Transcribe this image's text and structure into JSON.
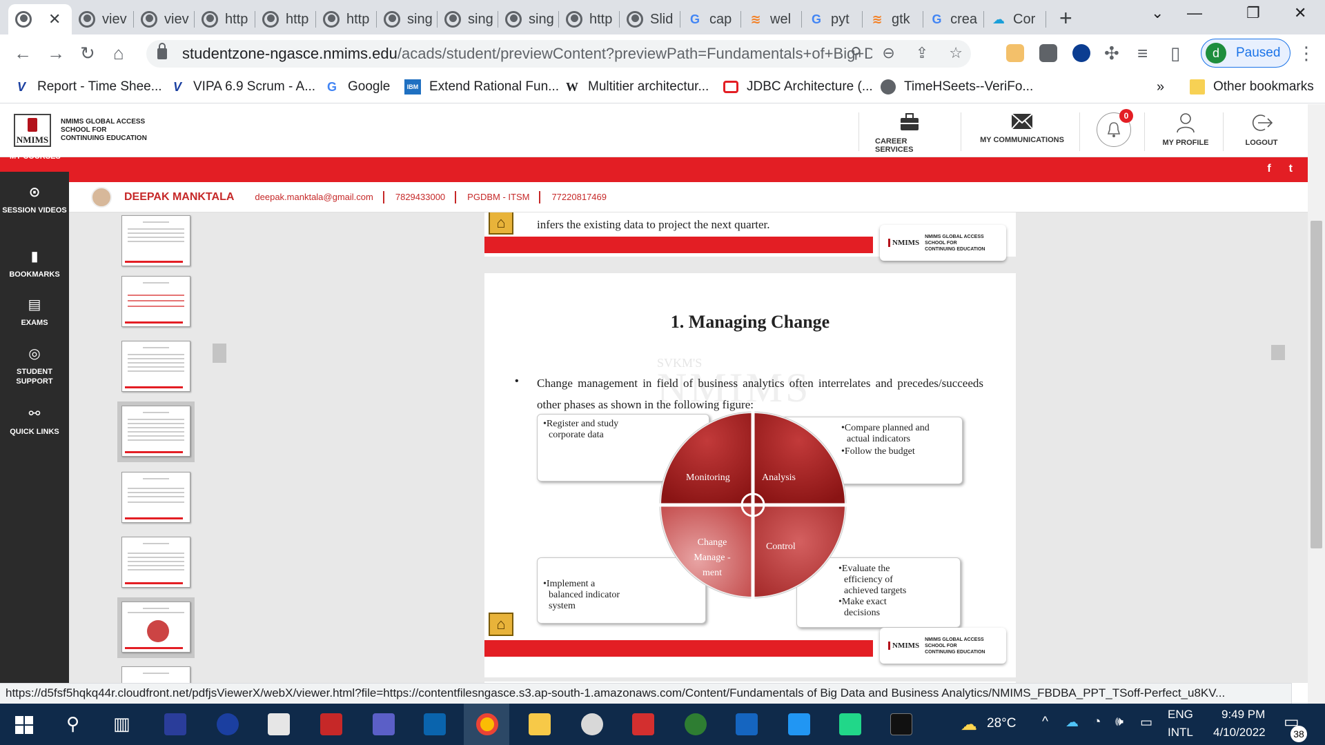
{
  "browser": {
    "tabs": [
      {
        "label": "",
        "active": true
      },
      {
        "label": "viev"
      },
      {
        "label": "viev"
      },
      {
        "label": "http"
      },
      {
        "label": "http"
      },
      {
        "label": "http"
      },
      {
        "label": "sing"
      },
      {
        "label": "sing"
      },
      {
        "label": "sing"
      },
      {
        "label": "http"
      },
      {
        "label": "Slid"
      },
      {
        "label": "cap"
      },
      {
        "label": "wel"
      },
      {
        "label": "pyt"
      },
      {
        "label": "gtk"
      },
      {
        "label": "crea"
      },
      {
        "label": "Cor"
      }
    ],
    "url_host": "studentzone-ngasce.nmims.edu",
    "url_path": "/acads/student/previewContent?previewPath=Fundamentals+of+Big+D...",
    "profile_initial": "d",
    "profile_label": "Paused",
    "bookmarks": [
      "Report - Time Shee...",
      "VIPA 6.9 Scrum - A...",
      "Google",
      "Extend Rational Fun...",
      "Multitier architectur...",
      "JDBC Architecture (...",
      "TimeHSeets--VeriFo..."
    ],
    "bookmarks_more": "»",
    "other_bookmarks": "Other bookmarks",
    "status_url": "https://d5fsf5hqkq44r.cloudfront.net/pdfjsViewerX/webX/viewer.html?file=https://contentfilesngasce.s3.ap-south-1.amazonaws.com/Content/Fundamentals of Big Data and Business Analytics/NMIMS_FBDBA_PPT_TSoff-Perfect_u8KV..."
  },
  "site": {
    "logo_abbr": "NMIMS",
    "logo_text": "NMIMS GLOBAL ACCESS SCHOOL FOR CONTINUING EDUCATION",
    "header_items": [
      "CAREER SERVICES",
      "MY COMMUNICATIONS",
      "MY PROFILE",
      "LOGOUT"
    ],
    "notification_count": "0",
    "my_courses": "MY COURSES",
    "social": [
      "f",
      "t"
    ]
  },
  "user": {
    "name": "DEEPAK MANKTALA",
    "email": "deepak.manktala@gmail.com",
    "phone": "7829433000",
    "program": "PGDBM - ITSM",
    "id": "77220817469"
  },
  "sidebar": {
    "items": [
      "SESSION VIDEOS",
      "BOOKMARKS",
      "EXAMS",
      "STUDENT SUPPORT",
      "QUICK LINKS"
    ]
  },
  "slide_prev": {
    "text": "infers the existing data to project the next quarter."
  },
  "slide": {
    "title": "1. Managing Change",
    "body": "Change management in field of business analytics often interrelates and precedes/succeeds other phases as shown in the following figure:",
    "watermark_small": "SVKM'S",
    "watermark_big": "NMIMS",
    "quadrants": [
      "Monitoring",
      "Analysis",
      "Change Manage -ment",
      "Control"
    ],
    "box_top_left": [
      "Register and study",
      "corporate data"
    ],
    "box_top_right": [
      "Compare planned and",
      "actual indicators",
      "Follow the budget"
    ],
    "box_bottom_left": [
      "Implement a",
      "balanced indicator",
      "system"
    ],
    "box_bottom_right": [
      "Evaluate the",
      "efficiency of",
      "achieved targets",
      "Make exact",
      "decisions"
    ]
  },
  "taskbar": {
    "weather": "28°C",
    "lang1": "ENG",
    "lang2": "INTL",
    "time": "9:49 PM",
    "date": "4/10/2022",
    "notif_count": "38"
  }
}
